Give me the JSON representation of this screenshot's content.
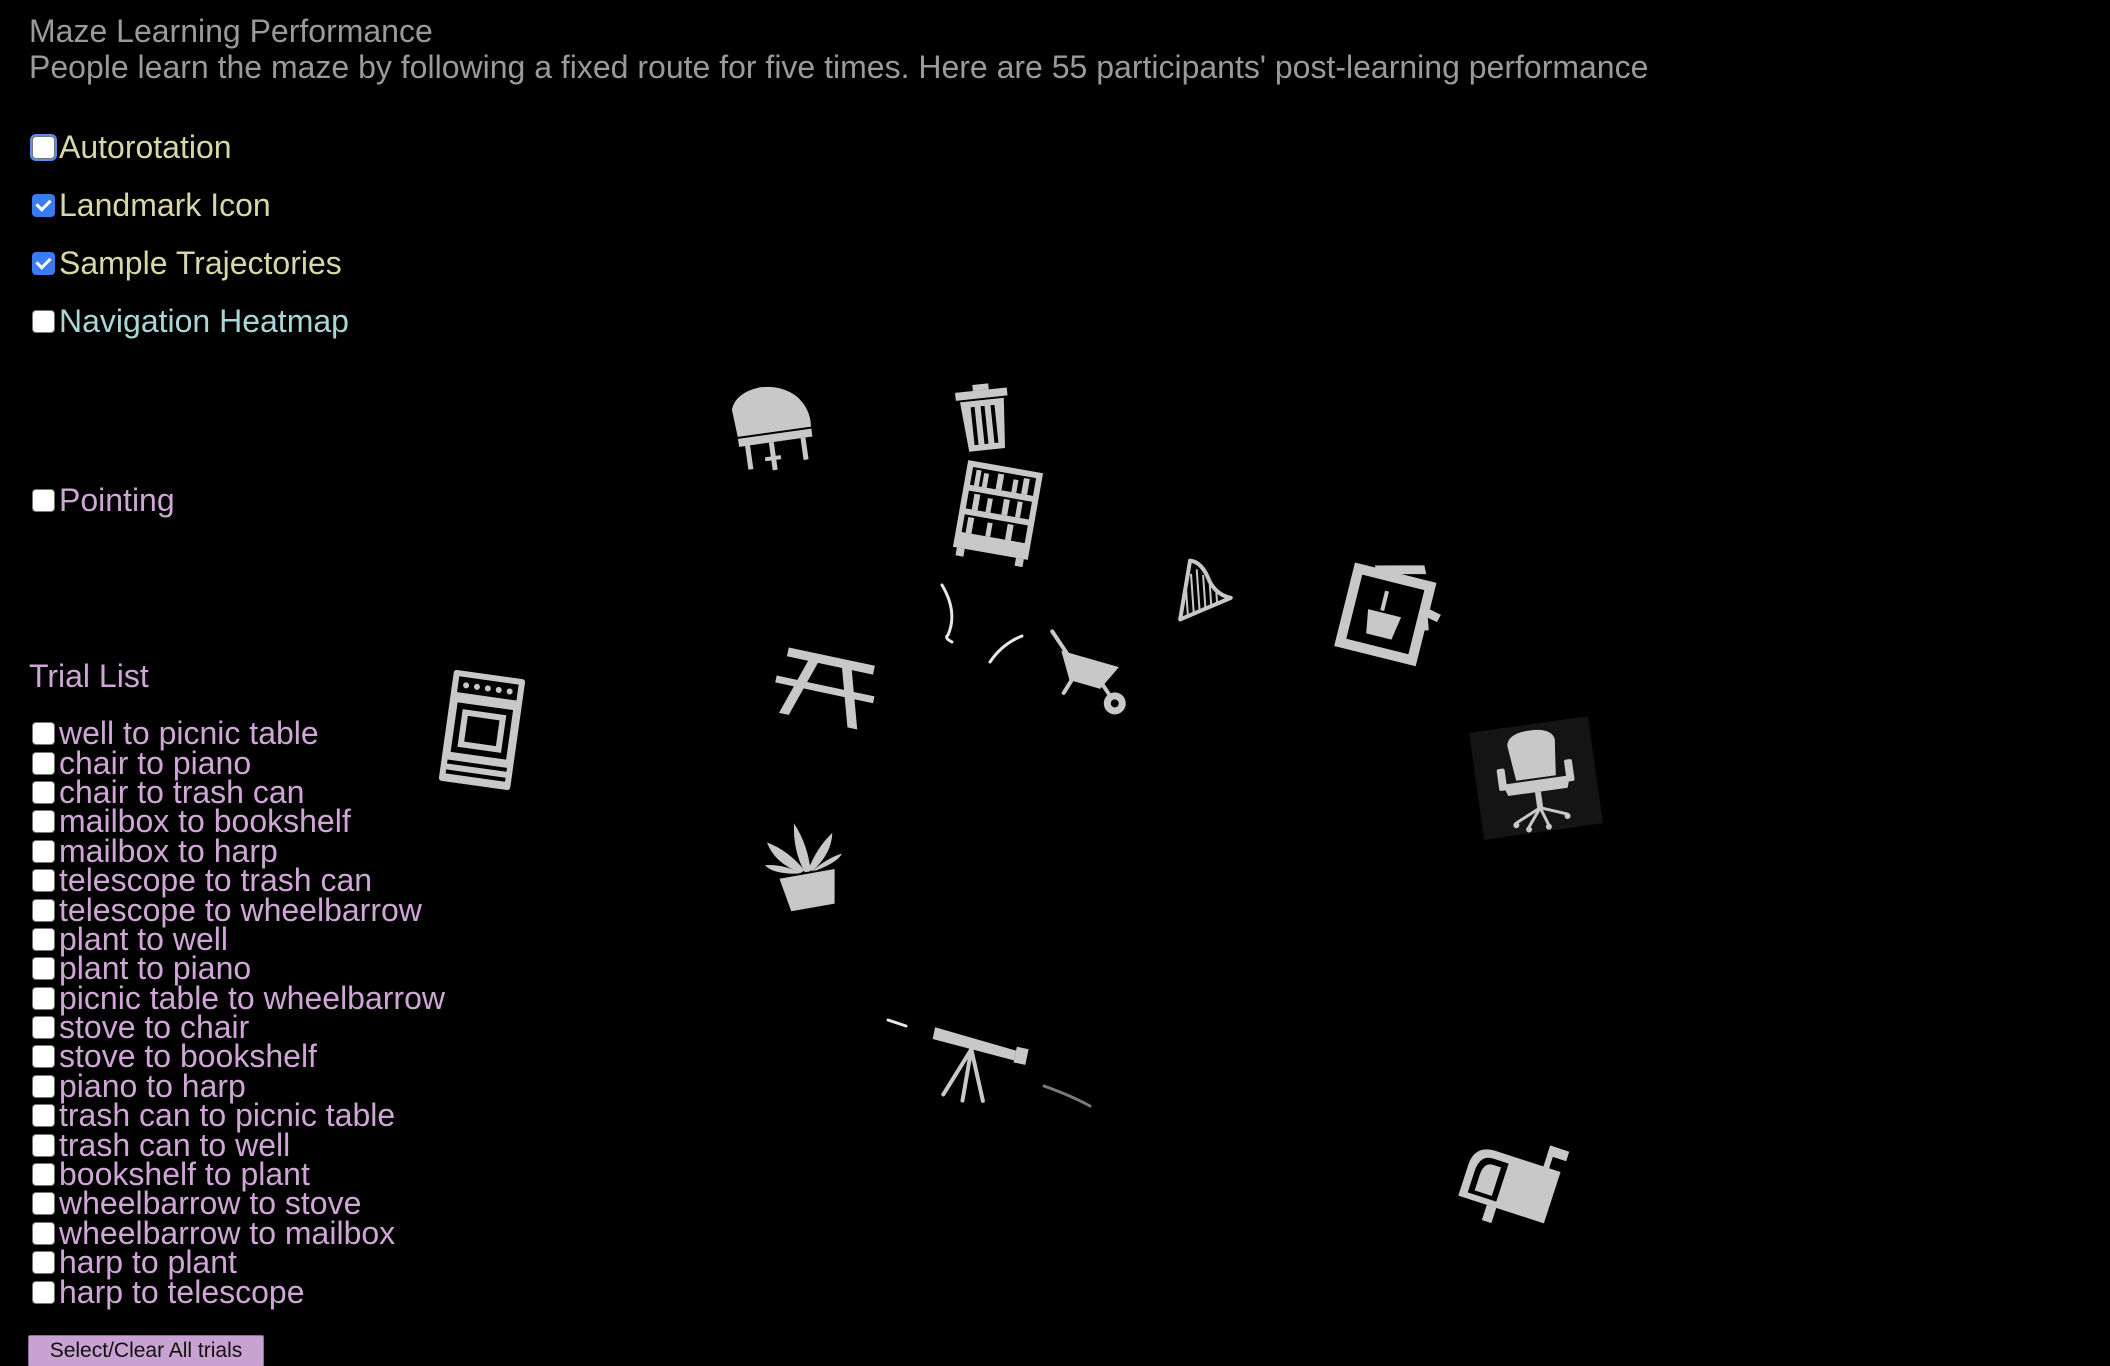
{
  "header": {
    "title": "Maze Learning Performance",
    "subtitle": "People learn the maze by following a fixed route for five times. Here are 55 participants' post-learning performance"
  },
  "options": [
    {
      "label": "Autorotation",
      "checked": false,
      "color": "#d9d6a8"
    },
    {
      "label": "Landmark Icon",
      "checked": true,
      "color": "#d9d6a8"
    },
    {
      "label": "Sample Trajectories",
      "checked": true,
      "color": "#d9d6a8"
    },
    {
      "label": "Navigation Heatmap",
      "checked": false,
      "color": "#a9d6d6"
    },
    {
      "label": "Pointing",
      "checked": false,
      "color": "#cfa6d6"
    }
  ],
  "trial_list": {
    "heading": "Trial List",
    "trials": [
      "well to picnic table",
      "chair to piano",
      "chair to trash can",
      "mailbox to bookshelf",
      "mailbox to harp",
      "telescope to trash can",
      "telescope to wheelbarrow",
      "plant to well",
      "plant to piano",
      "picnic table to wheelbarrow",
      "stove to chair",
      "stove to bookshelf",
      "piano to harp",
      "trash can to picnic table",
      "trash can to well",
      "bookshelf to plant",
      "wheelbarrow to stove",
      "wheelbarrow to mailbox",
      "harp to plant",
      "harp to telescope"
    ],
    "select_clear_label": "Select/Clear All trials"
  },
  "landmarks": [
    {
      "name": "piano",
      "icon": "piano-icon"
    },
    {
      "name": "trash can",
      "icon": "trash-can-icon"
    },
    {
      "name": "bookshelf",
      "icon": "bookshelf-icon"
    },
    {
      "name": "harp",
      "icon": "harp-icon"
    },
    {
      "name": "well",
      "icon": "well-icon"
    },
    {
      "name": "picnic table",
      "icon": "picnic-table-icon"
    },
    {
      "name": "wheelbarrow",
      "icon": "wheelbarrow-icon"
    },
    {
      "name": "stove",
      "icon": "stove-icon"
    },
    {
      "name": "chair",
      "icon": "chair-icon"
    },
    {
      "name": "plant",
      "icon": "plant-icon"
    },
    {
      "name": "telescope",
      "icon": "telescope-icon"
    },
    {
      "name": "mailbox",
      "icon": "mailbox-icon"
    }
  ],
  "colors": {
    "background": "#000000",
    "header_text": "#9a9a9a",
    "trial_text": "#cfa6d6",
    "icon_fill": "#c8c8c8",
    "checkbox_checked": "#3a7bf0",
    "button_bg": "#c8a2d0"
  }
}
